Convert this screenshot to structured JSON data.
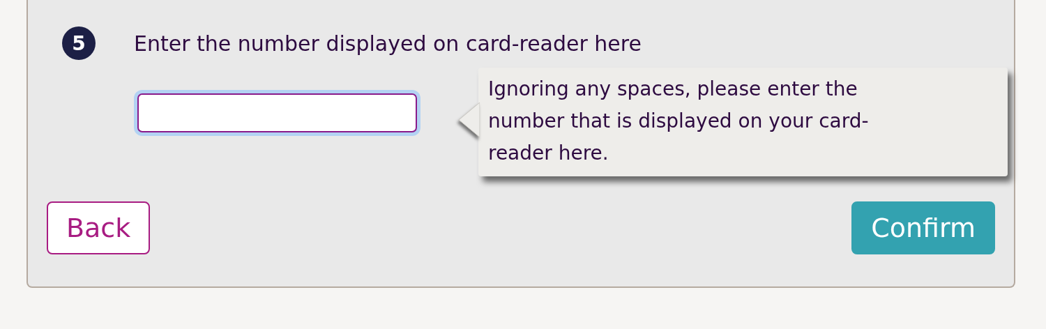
{
  "step": {
    "number": "5",
    "label": "Enter the number displayed on card-reader here"
  },
  "code_field": {
    "focused": true
  },
  "tooltip": {
    "text": "Ignoring any spaces, please enter the number that is displayed on your card-reader here."
  },
  "buttons": [
    {
      "kind": "secondary",
      "label": "Back"
    },
    {
      "kind": "primary",
      "label": "Confirm"
    }
  ]
}
